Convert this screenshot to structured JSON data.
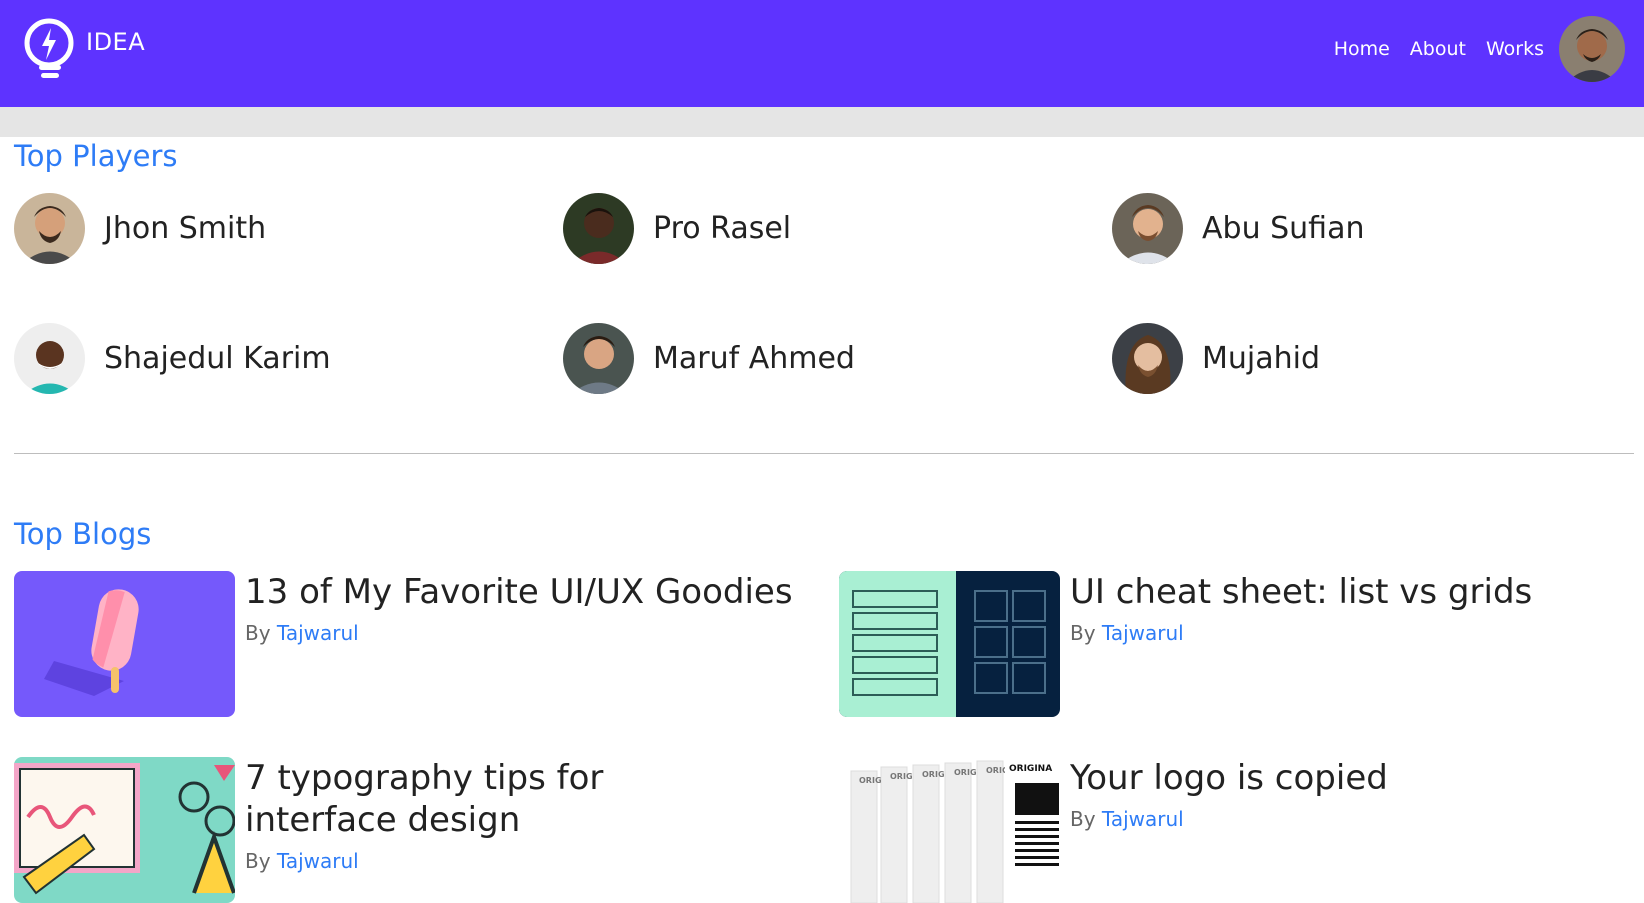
{
  "brand": {
    "name": "IDEA",
    "logo_icon": "lightbulb-bolt-icon"
  },
  "nav": {
    "links": [
      "Home",
      "About",
      "Works"
    ],
    "avatar_icon": "user-avatar"
  },
  "colors": {
    "navbar": "#5e33ff",
    "heading": "#2e7cf6",
    "link": "#2e7cf6"
  },
  "players": {
    "title": "Top Players",
    "items": [
      {
        "name": "Jhon Smith"
      },
      {
        "name": "Pro Rasel"
      },
      {
        "name": "Abu Sufian"
      },
      {
        "name": "Shajedul Karim"
      },
      {
        "name": "Maruf Ahmed"
      },
      {
        "name": "Mujahid"
      }
    ]
  },
  "blogs": {
    "title": "Top Blogs",
    "items": [
      {
        "title": "13 of My Favorite UI/UX Goodies",
        "by": "By",
        "author": "Tajwarul"
      },
      {
        "title": "UI cheat sheet: list vs grids",
        "by": "By",
        "author": "Tajwarul"
      },
      {
        "title": "7 typography tips for interface design",
        "by": "By",
        "author": "Tajwarul"
      },
      {
        "title": "Your logo is copied",
        "by": "By",
        "author": "Tajwarul"
      }
    ],
    "thumb_text": {
      "copy_label": "ORIG",
      "original_label": "ORIGINA"
    }
  }
}
